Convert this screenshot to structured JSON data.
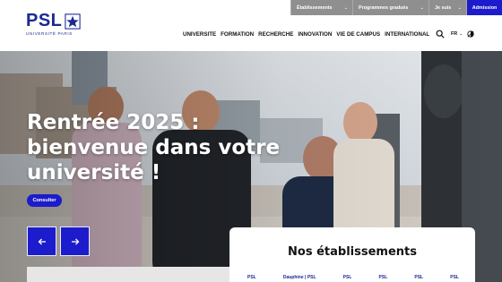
{
  "utility_bar": {
    "etablissements": "Établissements",
    "programmes": "Programmes gradués",
    "je_suis": "Je suis",
    "admission": "Admission"
  },
  "logo": {
    "name": "PSL",
    "subtitle": "UNIVERSITÉ PARIS"
  },
  "nav": {
    "items": [
      "UNIVERSITE",
      "FORMATION",
      "RECHERCHE",
      "INNOVATION",
      "VIE DE CAMPUS",
      "INTERNATIONAL"
    ]
  },
  "tools": {
    "lang": "FR"
  },
  "hero": {
    "title_lines": [
      "Rentrée 2025 :",
      "bienvenue dans votre",
      "université !"
    ],
    "cta": "Consulter"
  },
  "etablissements_panel": {
    "title": "Nos établissements",
    "logos": [
      "PSL",
      "Dauphine | PSL",
      "PSL",
      "PSL",
      "PSL",
      "PSL"
    ]
  },
  "colors": {
    "accent": "#1c1ccc",
    "brand": "#1a2a8f",
    "utility_gray": "#8f8f8f"
  }
}
